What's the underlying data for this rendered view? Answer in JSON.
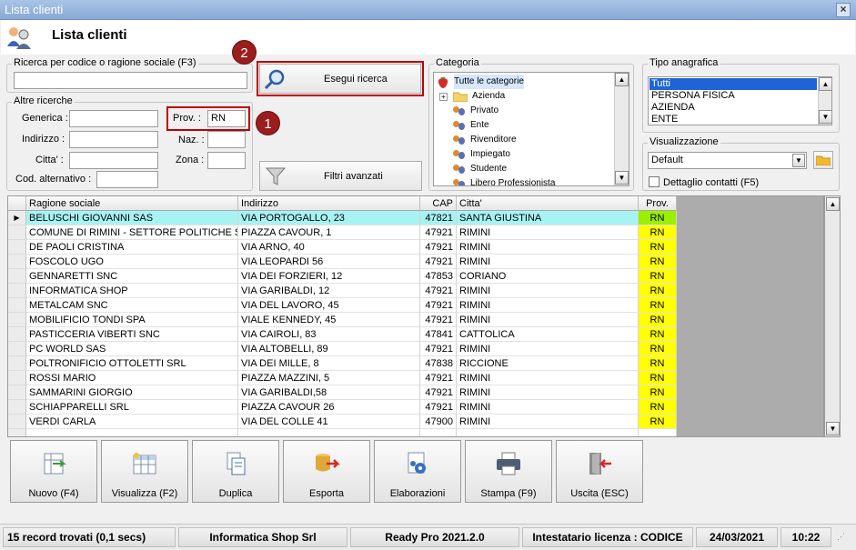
{
  "window": {
    "title": "Lista clienti",
    "close_glyph": "×"
  },
  "header": {
    "title": "Lista clienti",
    "icon": "customers-icon"
  },
  "search_code": {
    "legend": "Ricerca per codice o ragione sociale (F3)",
    "value": ""
  },
  "other_search": {
    "legend": "Altre ricerche",
    "generica_label": "Generica :",
    "generica_value": "",
    "indirizzo_label": "Indirizzo :",
    "indirizzo_value": "",
    "citta_label": "Citta' :",
    "citta_value": "",
    "codalt_label": "Cod. alternativo :",
    "codalt_value": "",
    "prov_label": "Prov. :",
    "prov_value": "RN",
    "naz_label": "Naz. :",
    "naz_value": "",
    "zona_label": "Zona :",
    "zona_value": ""
  },
  "buttons": {
    "search": "Esegui ricerca",
    "filters": "Filtri avanzati"
  },
  "badges": {
    "one": "1",
    "two": "2"
  },
  "categoria": {
    "legend": "Categoria",
    "items": [
      {
        "label": "Tutte le categorie",
        "icon": "strawberry-icon"
      },
      {
        "label": "Azienda",
        "icon": "folder-icon",
        "expander": "+"
      },
      {
        "label": "Privato",
        "icon": "people-icon"
      },
      {
        "label": "Ente",
        "icon": "people-icon"
      },
      {
        "label": "Rivenditore",
        "icon": "people-icon"
      },
      {
        "label": "Impiegato",
        "icon": "people-icon"
      },
      {
        "label": "Studente",
        "icon": "people-icon"
      },
      {
        "label": "Libero Professionista",
        "icon": "people-icon"
      }
    ]
  },
  "tipo": {
    "legend": "Tipo anagrafica",
    "items": [
      "Tutti",
      "PERSONA FISICA",
      "AZIENDA",
      "ENTE"
    ],
    "selected": "Tutti"
  },
  "visual": {
    "legend": "Visualizzazione",
    "selected": "Default",
    "contacts_label": "Dettaglio contatti (F5)"
  },
  "grid": {
    "columns": [
      "Ragione sociale",
      "Indirizzo",
      "CAP",
      "Citta'",
      "Prov."
    ],
    "rows": [
      [
        "BELUSCHI GIOVANNI SAS",
        "VIA PORTOGALLO, 23",
        "47821",
        "SANTA GIUSTINA",
        "RN"
      ],
      [
        "COMUNE DI RIMINI - SETTORE POLITICHE S...",
        "PIAZZA CAVOUR, 1",
        "47921",
        "RIMINI",
        "RN"
      ],
      [
        "DE PAOLI CRISTINA",
        "VIA ARNO, 40",
        "47921",
        "RIMINI",
        "RN"
      ],
      [
        "FOSCOLO UGO",
        "VIA LEOPARDI 56",
        "47921",
        "RIMINI",
        "RN"
      ],
      [
        "GENNARETTI SNC",
        "VIA DEI FORZIERI, 12",
        "47853",
        "CORIANO",
        "RN"
      ],
      [
        "INFORMATICA SHOP",
        "VIA GARIBALDI, 12",
        "47921",
        "RIMINI",
        "RN"
      ],
      [
        "METALCAM SNC",
        "VIA DEL LAVORO, 45",
        "47921",
        "RIMINI",
        "RN"
      ],
      [
        "MOBILIFICIO TONDI SPA",
        "VIALE KENNEDY, 45",
        "47921",
        "RIMINI",
        "RN"
      ],
      [
        "PASTICCERIA VIBERTI SNC",
        "VIA CAIROLI, 83",
        "47841",
        "CATTOLICA",
        "RN"
      ],
      [
        "PC WORLD SAS",
        "VIA ALTOBELLI, 89",
        "47921",
        "RIMINI",
        "RN"
      ],
      [
        "POLTRONIFICIO OTTOLETTI SRL",
        "VIA DEI MILLE, 8",
        "47838",
        "RICCIONE",
        "RN"
      ],
      [
        "ROSSI MARIO",
        "PIAZZA MAZZINI, 5",
        "47921",
        "RIMINI",
        "RN"
      ],
      [
        "SAMMARINI GIORGIO",
        "VIA GARIBALDI,58",
        "47921",
        "RIMINI",
        "RN"
      ],
      [
        "SCHIAPPARELLI SRL",
        "PIAZZA CAVOUR 26",
        "47921",
        "RIMINI",
        "RN"
      ],
      [
        "VERDI CARLA",
        "VIA DEL COLLE 41",
        "47900",
        "RIMINI",
        "RN"
      ]
    ]
  },
  "actions": [
    {
      "label": "Nuovo (F4)",
      "icon": "new-record-icon"
    },
    {
      "label": "Visualizza (F2)",
      "icon": "view-table-icon"
    },
    {
      "label": "Duplica",
      "icon": "duplicate-icon"
    },
    {
      "label": "Esporta",
      "icon": "export-icon"
    },
    {
      "label": "Elaborazioni",
      "icon": "process-gear-icon"
    },
    {
      "label": "Stampa (F9)",
      "icon": "printer-icon"
    },
    {
      "label": "Uscita (ESC)",
      "icon": "exit-door-icon"
    }
  ],
  "status": {
    "records": "15 record trovati (0,1 secs)",
    "company": "Informatica Shop Srl",
    "version": "Ready Pro 2021.2.0",
    "license": "Intestatario licenza : CODICE SRI",
    "date": "24/03/2021",
    "time": "10:22"
  },
  "colors": {
    "title_bar": "#88a9d6",
    "highlight_row": "#a7f3f3",
    "prov_cell": "#ffff00",
    "annotation": "#c00000"
  }
}
